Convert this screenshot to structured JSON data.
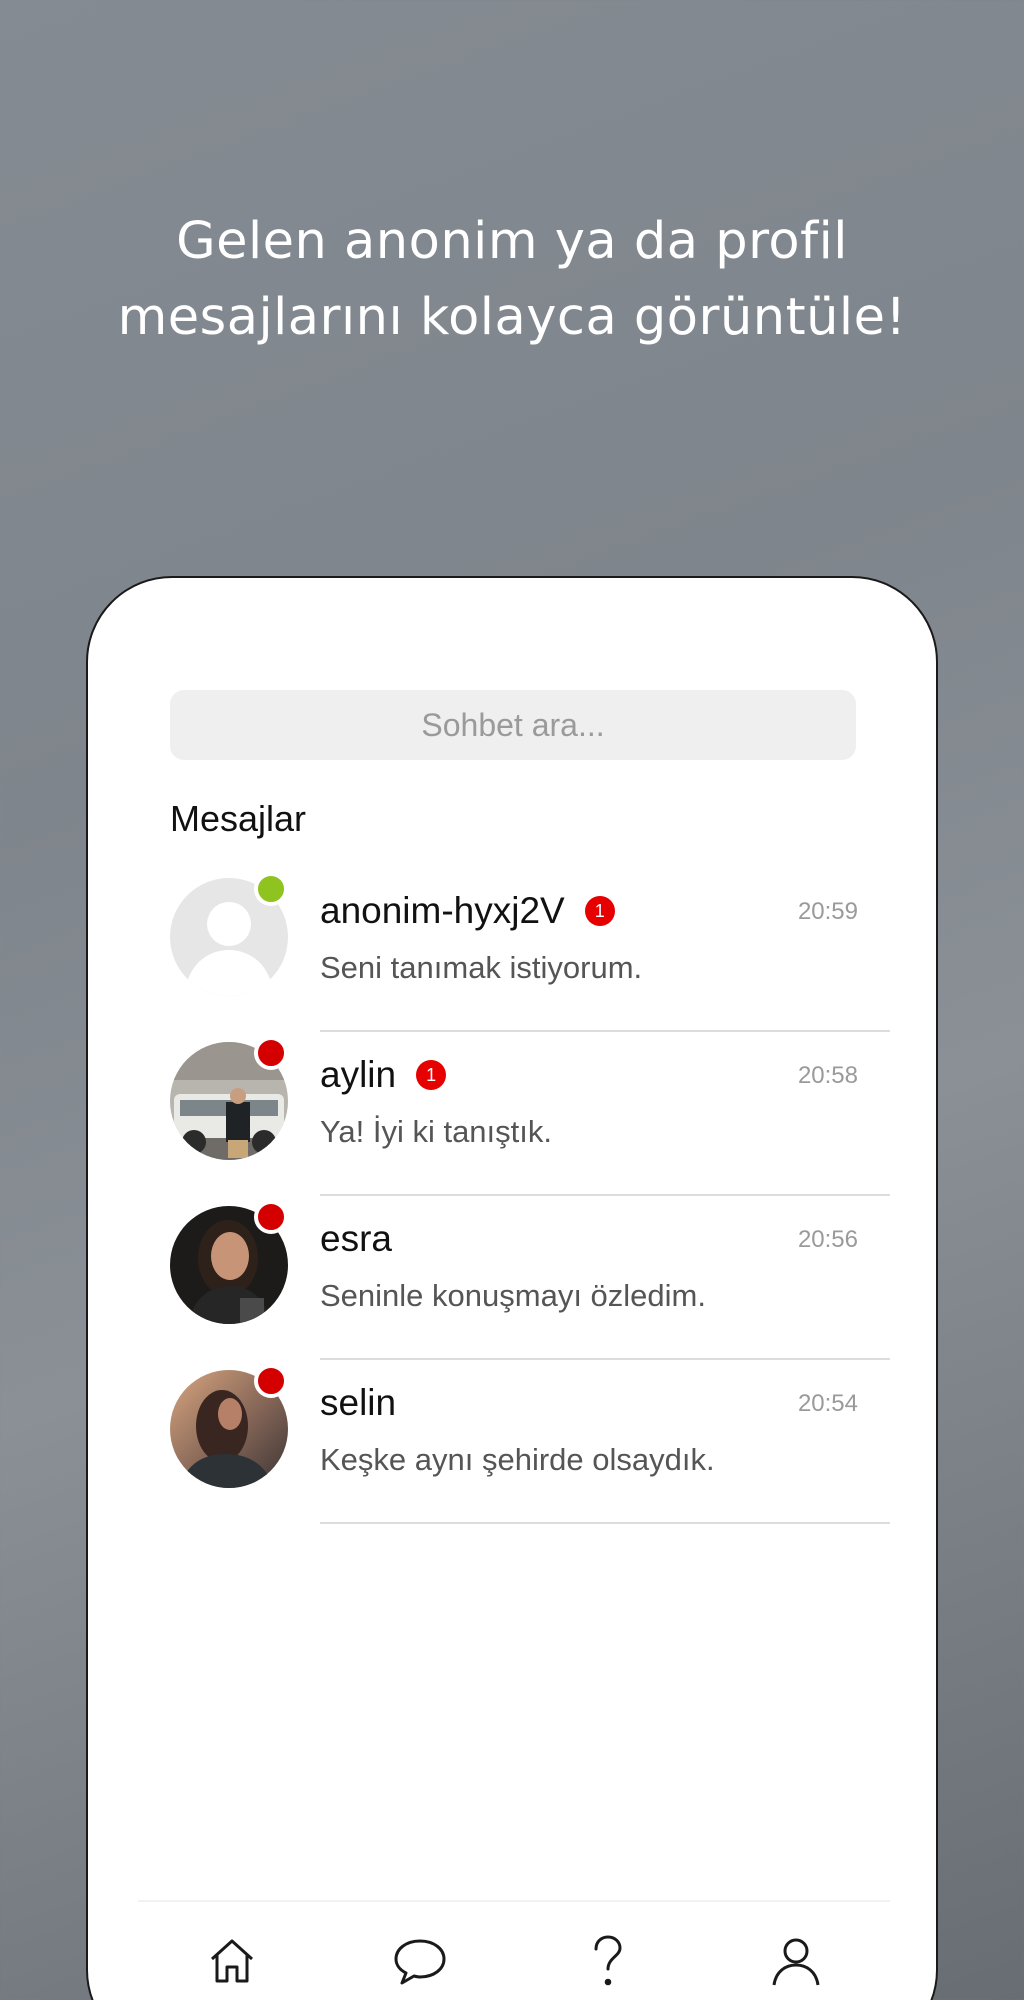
{
  "headline": {
    "line1": "Gelen anonim ya da profil",
    "line2": "mesajlarını kolayca görüntüle!"
  },
  "search": {
    "placeholder": "Sohbet ara..."
  },
  "section_title": "Mesajlar",
  "chats": [
    {
      "name": "anonim-hyxj2V",
      "badge": "1",
      "time": "20:59",
      "message": "Seni tanımak istiyorum.",
      "status": "online",
      "status_color": "#8fc31f",
      "avatar": "default-avatar"
    },
    {
      "name": "aylin",
      "badge": "1",
      "time": "20:58",
      "message": "Ya! İyi ki tanıştık.",
      "status": "offline",
      "status_color": "#d40000",
      "avatar": "photo-avatar"
    },
    {
      "name": "esra",
      "badge": "",
      "time": "20:56",
      "message": "Seninle konuşmayı özledim.",
      "status": "offline",
      "status_color": "#d40000",
      "avatar": "photo-avatar"
    },
    {
      "name": "selin",
      "badge": "",
      "time": "20:54",
      "message": "Keşke aynı şehirde olsaydık.",
      "status": "offline",
      "status_color": "#d40000",
      "avatar": "photo-avatar"
    }
  ],
  "tabbar": {
    "icons": [
      "home-icon",
      "chat-bubble-icon",
      "question-icon",
      "profile-icon"
    ]
  }
}
